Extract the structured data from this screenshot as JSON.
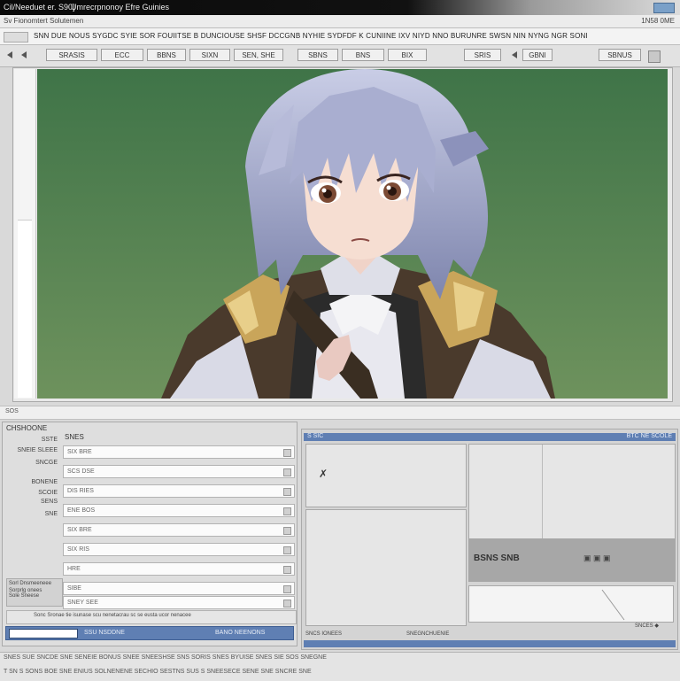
{
  "window": {
    "title": "Cil/Needuet er. S90]",
    "subtitle": "Umrecrpnonoy Efre Guinies"
  },
  "menubar_top": {
    "left": "Sv Fionomtert   Solutemen",
    "right": "1N58 0ME"
  },
  "menubar_main": {
    "items": "SNN  DUE  NOUS  SYGDC  SYIE   SOR  FOUIITSE  B  DUNCIOUSE  SHSF  DCCGNB  NYHIE  SYDFDF  K CUNIINE  IXV  NIYD  NNO  BURUNRE  SWSN  NIN  NYNG  NGR  SONI"
  },
  "toolbar": {
    "buttons": [
      "SRASIS",
      "ECC",
      "BBNS",
      "SIXN",
      "SEN, SHE",
      "SBNS",
      "BNS",
      "BIX",
      "SRIS",
      "GBNI",
      "SBNUS"
    ]
  },
  "left_panel": {
    "title": "CHSHOONE",
    "subtitle": "SNES",
    "labels": [
      "SSTE",
      "SNEIE SLEEE",
      "SNCGE",
      "BONENE",
      "SCOIE",
      "SENS",
      "SNE"
    ],
    "rows": [
      "SIX BRE",
      "SCS DSE",
      "DIS RIES",
      "ENE BOS",
      "SIX BRE",
      "SIX RIS",
      "HRE",
      "SIBE",
      "SNEY SEE"
    ],
    "notes": [
      "Sorl Dnsmeeneee",
      "Sorprlg onees",
      "Sole Sneese"
    ],
    "footer_caption": "Sonc Sronae tie isunase scu nenetacrau sc se eusta ucor nenacee",
    "footer_left": "SSU NSDDNE",
    "footer_right": "BANO NEENONS"
  },
  "right_panel": {
    "header_left": "S SIC",
    "header_right": "BTC NE SCOLE",
    "gray_label": "BSNS SNB",
    "gray_icons": "▣ ▣ ▣",
    "bottom_left": "SNCS IONEES",
    "bottom_mid": "SNEGNCHUENIE",
    "bottom_right": "SNCES ◆"
  },
  "status_strip": {
    "text": "SOS"
  },
  "bottom_bar": {
    "line1": "SNES    SUE  SNCDE SNE  SENEIE  BONUS  SNEE    SNEESHSE  SNS  SORIS  SNES   BYUISE  SNES  SIE  SOS  SNEGNE",
    "line2": "T SN   S  SONS  BOE  SNE  ENIUS  SOLNENENE  SECHIO  SESTNS  SUS  S  SNEESECE  SENE  SNE  SNCRE  SNE"
  },
  "colors": {
    "canvas_bg": "#4b7b50",
    "accent_blue": "#5f7fb3",
    "hair": "#9aa3c4"
  }
}
